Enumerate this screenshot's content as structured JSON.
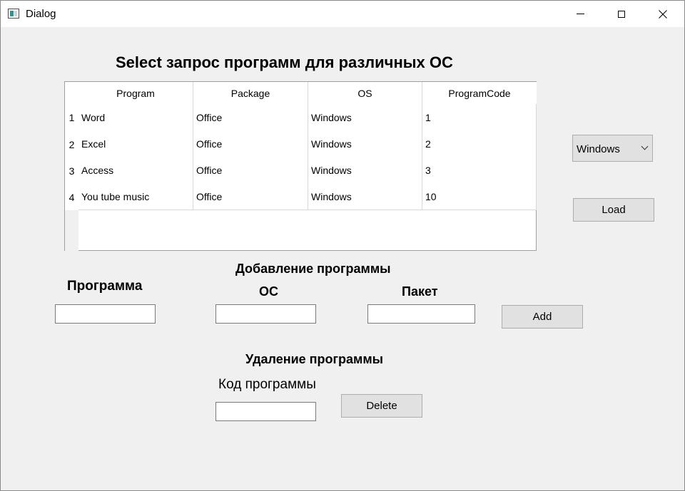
{
  "window": {
    "title": "Dialog",
    "close_glyph": "✕"
  },
  "main_title": "Select запрос программ для различных ОС",
  "table": {
    "columns": [
      "Program",
      "Package",
      "OS",
      "ProgramCode"
    ],
    "rows": [
      {
        "num": "1",
        "cells": [
          "Word",
          "Office",
          "Windows",
          "1"
        ]
      },
      {
        "num": "2",
        "cells": [
          "Excel",
          "Office",
          "Windows",
          "2"
        ]
      },
      {
        "num": "3",
        "cells": [
          "Access",
          "Office",
          "Windows",
          "3"
        ]
      },
      {
        "num": "4",
        "cells": [
          "You tube music",
          "Office",
          "Windows",
          "10"
        ]
      }
    ]
  },
  "os_combo": {
    "selected": "Windows"
  },
  "buttons": {
    "load": "Load",
    "add": "Add",
    "delete": "Delete"
  },
  "add_section": {
    "title": "Добавление программы",
    "program_label": "Программа",
    "os_label": "ОС",
    "package_label": "Пакет",
    "program_value": "",
    "os_value": "",
    "package_value": ""
  },
  "delete_section": {
    "title": "Удаление программы",
    "code_label": "Код программы",
    "code_value": ""
  },
  "icons": {
    "app": "app-icon",
    "minimize": "minimize-icon",
    "maximize": "maximize-icon",
    "close": "close-icon",
    "dropdown": "chevron-down-icon"
  }
}
